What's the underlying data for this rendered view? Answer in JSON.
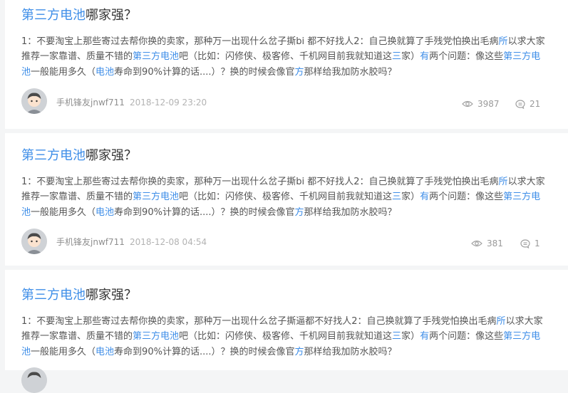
{
  "posts": [
    {
      "title_hl": "第三方电池",
      "title_rest": "哪家强？",
      "body": [
        {
          "t": "1：不要淘宝上那些寄过去帮你换的卖家，那种万一出现什么岔子撕bi 都不好找人2：自己换就算了手残党怕换出毛病",
          "hl": false
        },
        {
          "t": "所",
          "hl": true
        },
        {
          "t": "以求大家推荐一家靠谱、质量不错的",
          "hl": false
        },
        {
          "t": "第三方电池",
          "hl": true
        },
        {
          "t": "吧（比如：闪修侠、极客修、千机网目前我就知道这",
          "hl": false
        },
        {
          "t": "三",
          "hl": true
        },
        {
          "t": "家）",
          "hl": false
        },
        {
          "t": "有",
          "hl": true
        },
        {
          "t": "两个问题：像这些",
          "hl": false
        },
        {
          "t": "第三方电池",
          "hl": true
        },
        {
          "t": "一般能用多久（",
          "hl": false
        },
        {
          "t": "电池",
          "hl": true
        },
        {
          "t": "寿命到90%计算的话....）？换的时候会像官",
          "hl": false
        },
        {
          "t": "方",
          "hl": true
        },
        {
          "t": "那样给我加防水胶吗？",
          "hl": false
        }
      ],
      "user": "手机锋友jnwf711",
      "time": "2018-12-09 23:20",
      "views": "3987",
      "comments": "21"
    },
    {
      "title_hl": "第三方电池",
      "title_rest": "哪家强？",
      "body": [
        {
          "t": "1：不要淘宝上那些寄过去帮你换的卖家，那种万一出现什么岔子撕bi 都不好找人2：自己换就算了手残党怕换出毛病",
          "hl": false
        },
        {
          "t": "所",
          "hl": true
        },
        {
          "t": "以求大家推荐一家靠谱、质量不错的",
          "hl": false
        },
        {
          "t": "第三方电池",
          "hl": true
        },
        {
          "t": "吧（比如：闪修侠、极客修、千机网目前我就知道这",
          "hl": false
        },
        {
          "t": "三",
          "hl": true
        },
        {
          "t": "家）",
          "hl": false
        },
        {
          "t": "有",
          "hl": true
        },
        {
          "t": "两个问题：像这些",
          "hl": false
        },
        {
          "t": "第三方电池",
          "hl": true
        },
        {
          "t": "一般能用多久（",
          "hl": false
        },
        {
          "t": "电池",
          "hl": true
        },
        {
          "t": "寿命到90%计算的话....）？换的时候会像官",
          "hl": false
        },
        {
          "t": "方",
          "hl": true
        },
        {
          "t": "那样给我加防水胶吗？",
          "hl": false
        }
      ],
      "user": "手机锋友jnwf711",
      "time": "2018-12-08 04:54",
      "views": "381",
      "comments": "1"
    },
    {
      "title_hl": "第三方电池",
      "title_rest": "哪家强？",
      "body": [
        {
          "t": "1：不要淘宝上那些寄过去帮你换的卖家，那种万一出现什么岔子撕逼都不好找人2：自己换就算了手残党怕换出毛病",
          "hl": false
        },
        {
          "t": "所",
          "hl": true
        },
        {
          "t": "以求大家推荐一家靠谱、质量不错的",
          "hl": false
        },
        {
          "t": "第三方电池",
          "hl": true
        },
        {
          "t": "吧（比如：闪修侠、极客修、千机网目前我就知道这",
          "hl": false
        },
        {
          "t": "三",
          "hl": true
        },
        {
          "t": "家）",
          "hl": false
        },
        {
          "t": "有",
          "hl": true
        },
        {
          "t": "两个问题：像这些",
          "hl": false
        },
        {
          "t": "第三方电池",
          "hl": true
        },
        {
          "t": "一般能用多久（",
          "hl": false
        },
        {
          "t": "电池",
          "hl": true
        },
        {
          "t": "寿命到90%计算的话....）？换的时候会像官",
          "hl": false
        },
        {
          "t": "方",
          "hl": true
        },
        {
          "t": "那样给我加防水胶吗？",
          "hl": false
        }
      ]
    }
  ],
  "icons": {
    "views": "eye-icon",
    "comments": "comment-icon",
    "avatar": "user-avatar"
  },
  "colors": {
    "highlight": "#3e8ee8",
    "title": "#333333",
    "body": "#555555",
    "meta": "#9a9a9a",
    "page_bg": "#f4f5f6",
    "card_bg": "#ffffff"
  }
}
